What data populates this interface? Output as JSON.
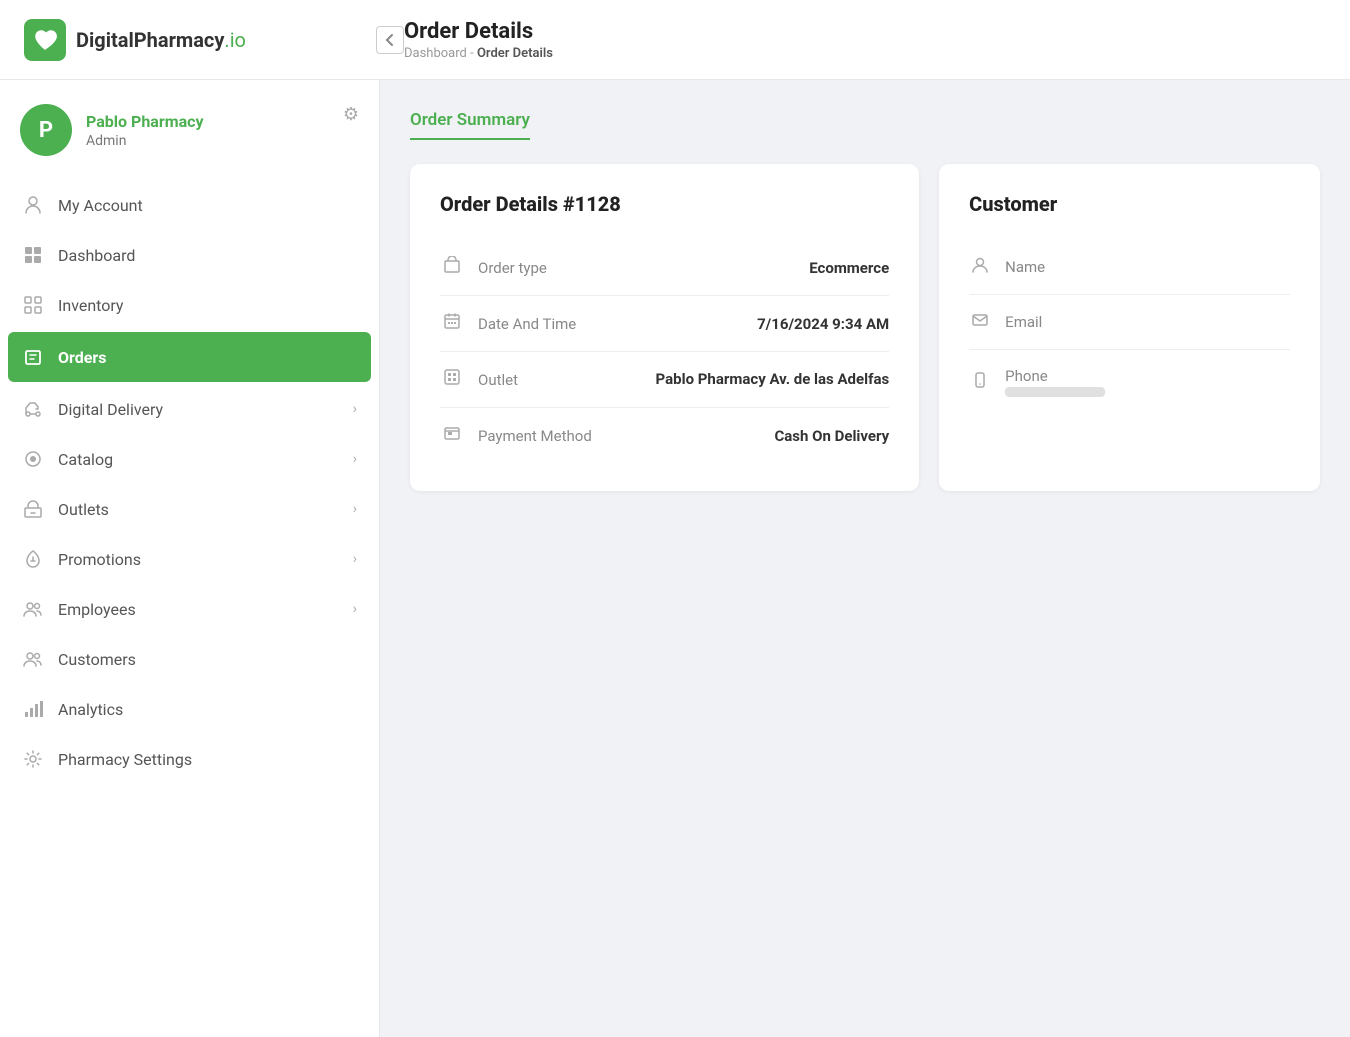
{
  "header": {
    "logo_name": "DigitalPharmacy",
    "logo_suffix": ".io",
    "page_title": "Order Details",
    "breadcrumb_root": "Dashboard",
    "breadcrumb_separator": "-",
    "breadcrumb_current": "Order Details"
  },
  "sidebar": {
    "pharmacy_name": "Pablo Pharmacy",
    "pharmacy_role": "Admin",
    "pharmacy_initial": "P",
    "nav_items": [
      {
        "id": "my-account",
        "label": "My Account",
        "icon": "👤",
        "chevron": false
      },
      {
        "id": "dashboard",
        "label": "Dashboard",
        "icon": "▦",
        "chevron": false
      },
      {
        "id": "inventory",
        "label": "Inventory",
        "icon": "▦",
        "chevron": false
      },
      {
        "id": "orders",
        "label": "Orders",
        "icon": "🛒",
        "chevron": false,
        "active": true
      },
      {
        "id": "digital-delivery",
        "label": "Digital Delivery",
        "icon": "🚴",
        "chevron": true
      },
      {
        "id": "catalog",
        "label": "Catalog",
        "icon": "🍀",
        "chevron": true
      },
      {
        "id": "outlets",
        "label": "Outlets",
        "icon": "🏛",
        "chevron": true
      },
      {
        "id": "promotions",
        "label": "Promotions",
        "icon": "📡",
        "chevron": true
      },
      {
        "id": "employees",
        "label": "Employees",
        "icon": "👥",
        "chevron": true
      },
      {
        "id": "customers",
        "label": "Customers",
        "icon": "👥",
        "chevron": false
      },
      {
        "id": "analytics",
        "label": "Analytics",
        "icon": "📊",
        "chevron": false
      },
      {
        "id": "pharmacy-settings",
        "label": "Pharmacy Settings",
        "icon": "⚙",
        "chevron": false
      }
    ]
  },
  "content": {
    "tab_label": "Order Summary",
    "order_title": "Order Details #1128",
    "fields": [
      {
        "id": "order-type",
        "label": "Order type",
        "value": "Ecommerce",
        "icon": "🏛"
      },
      {
        "id": "date-time",
        "label": "Date And Time",
        "value": "7/16/2024 9:34 AM",
        "icon": "📅"
      },
      {
        "id": "outlet",
        "label": "Outlet",
        "value": "Pablo Pharmacy Av. de las Adelfas",
        "icon": "🖥"
      },
      {
        "id": "payment-method",
        "label": "Payment Method",
        "value": "Cash On Delivery",
        "icon": "🖥"
      }
    ],
    "customer_title": "Customer",
    "customer_fields": [
      {
        "id": "name",
        "label": "Name",
        "icon": "👤",
        "has_placeholder": false
      },
      {
        "id": "email",
        "label": "Email",
        "icon": "✉",
        "has_placeholder": false
      },
      {
        "id": "phone",
        "label": "Phone",
        "icon": "📱",
        "has_placeholder": true
      }
    ]
  }
}
